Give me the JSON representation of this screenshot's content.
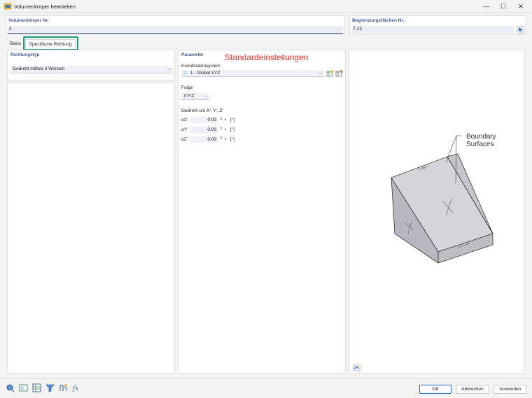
{
  "window": {
    "title": "Volumenkörper bearbeiten",
    "minimize": "—",
    "maximize": "☐",
    "close": "✕"
  },
  "header": {
    "solid_no_label": "Volumenkörper Nr.",
    "solid_no_value": "2",
    "boundary_label": "Begrenzungsflächen Nr.",
    "boundary_value": "7-12"
  },
  "tabs": [
    {
      "label": "Basis"
    },
    {
      "label": "Spezifische Richtung"
    }
  ],
  "left": {
    "section_title": "Richtungstyp",
    "direction_type": "Gedreht mittels 3 Winkeln"
  },
  "params": {
    "section_title": "Parameter",
    "overlay_note": "Standardeinstellungen",
    "coord_label": "Koordinatensystem",
    "coord_value": "1 - Global XYZ",
    "sequence_label": "Folge",
    "sequence_value": "X'Y'Z'",
    "rotated_label": "Gedreht um X', Y', Z'",
    "angles": [
      {
        "symbol": "αX'",
        "value": "0.00",
        "unit": "[°]"
      },
      {
        "symbol": "αY'",
        "value": "0.00",
        "unit": "[°]"
      },
      {
        "symbol": "αZ'",
        "value": "0.00",
        "unit": "[°]"
      }
    ]
  },
  "preview": {
    "callout_line1": "Boundary",
    "callout_line2": "Surfaces"
  },
  "footer": {
    "ok": "OK",
    "cancel": "Abbrechen",
    "apply": "Anwenden"
  },
  "colors": {
    "accent": "#4a5a8a",
    "highlight": "#1e9a7c",
    "note": "#e8352f"
  }
}
